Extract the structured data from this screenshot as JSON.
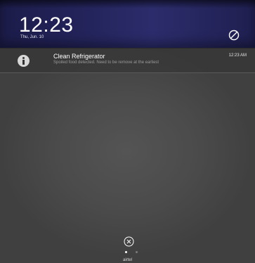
{
  "header": {
    "time": "12:23",
    "date": "Thu, Jun. 10"
  },
  "notification": {
    "title": "Clean Refrigerator",
    "body": "Spoiled food detected. Need to be remove at the earliest",
    "time": "12:23 AM",
    "icon": "info-icon"
  },
  "footer": {
    "carrier": "airtel",
    "page_count": 2,
    "active_page": 1
  },
  "icons": {
    "dnd": "do-not-disturb-icon",
    "clear": "clear-all-icon"
  },
  "colors": {
    "header_bg": "#24245c",
    "panel_bg": "#4b4b4b",
    "text_primary": "#ffffff",
    "text_secondary": "#9a9a9a"
  }
}
